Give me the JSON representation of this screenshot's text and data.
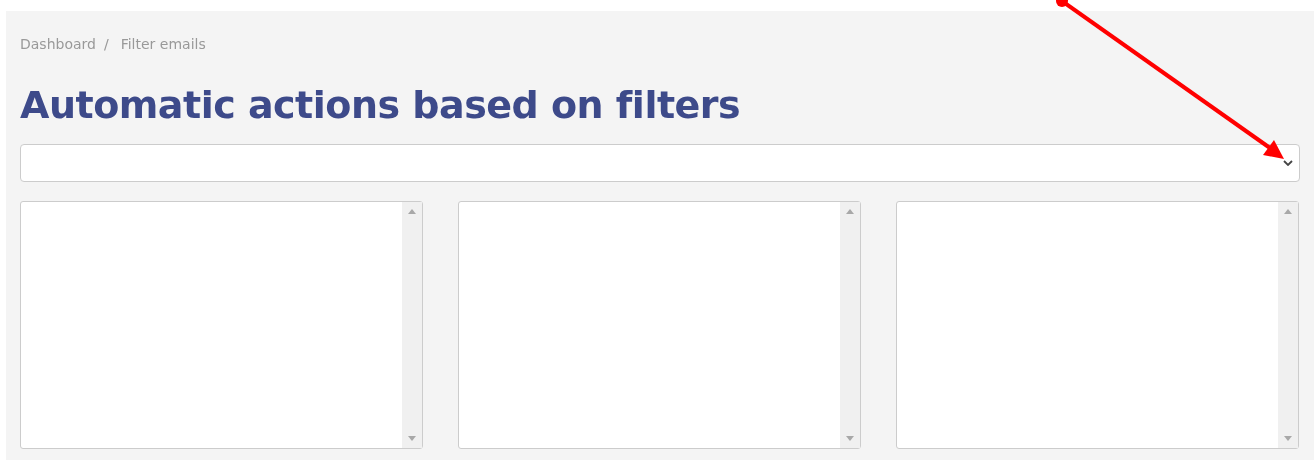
{
  "breadcrumb": [
    {
      "label": "Dashboard",
      "separator": "/"
    },
    {
      "label": "Filter emails"
    }
  ],
  "title": "Automatic actions based on filters",
  "select": {
    "kind": "dropdown"
  },
  "listboxes": [
    {
      "kind": "listbox"
    },
    {
      "kind": "listbox"
    },
    {
      "kind": "listbox"
    }
  ],
  "annotation": {
    "kind": "arrow"
  }
}
